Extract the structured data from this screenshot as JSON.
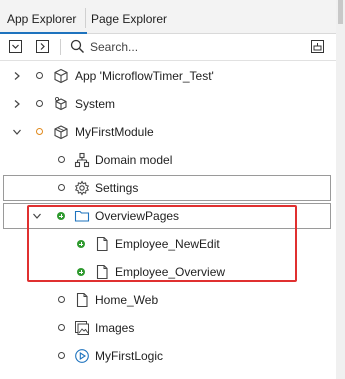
{
  "tabs": {
    "app_explorer": "App Explorer",
    "page_explorer": "Page Explorer"
  },
  "toolbar": {
    "search_placeholder": "Search..."
  },
  "tree": {
    "app": "App 'MicroflowTimer_Test'",
    "system": "System",
    "module": "MyFirstModule",
    "domain_model": "Domain model",
    "settings": "Settings",
    "overview_pages": "OverviewPages",
    "employee_newedit": "Employee_NewEdit",
    "employee_overview": "Employee_Overview",
    "home_web": "Home_Web",
    "images": "Images",
    "my_first_logic": "MyFirstLogic"
  },
  "colors": {
    "accent": "#1e73be",
    "highlight": "#e03030",
    "status_added": "#2f9a2f",
    "status_modified": "#e08a1e"
  }
}
